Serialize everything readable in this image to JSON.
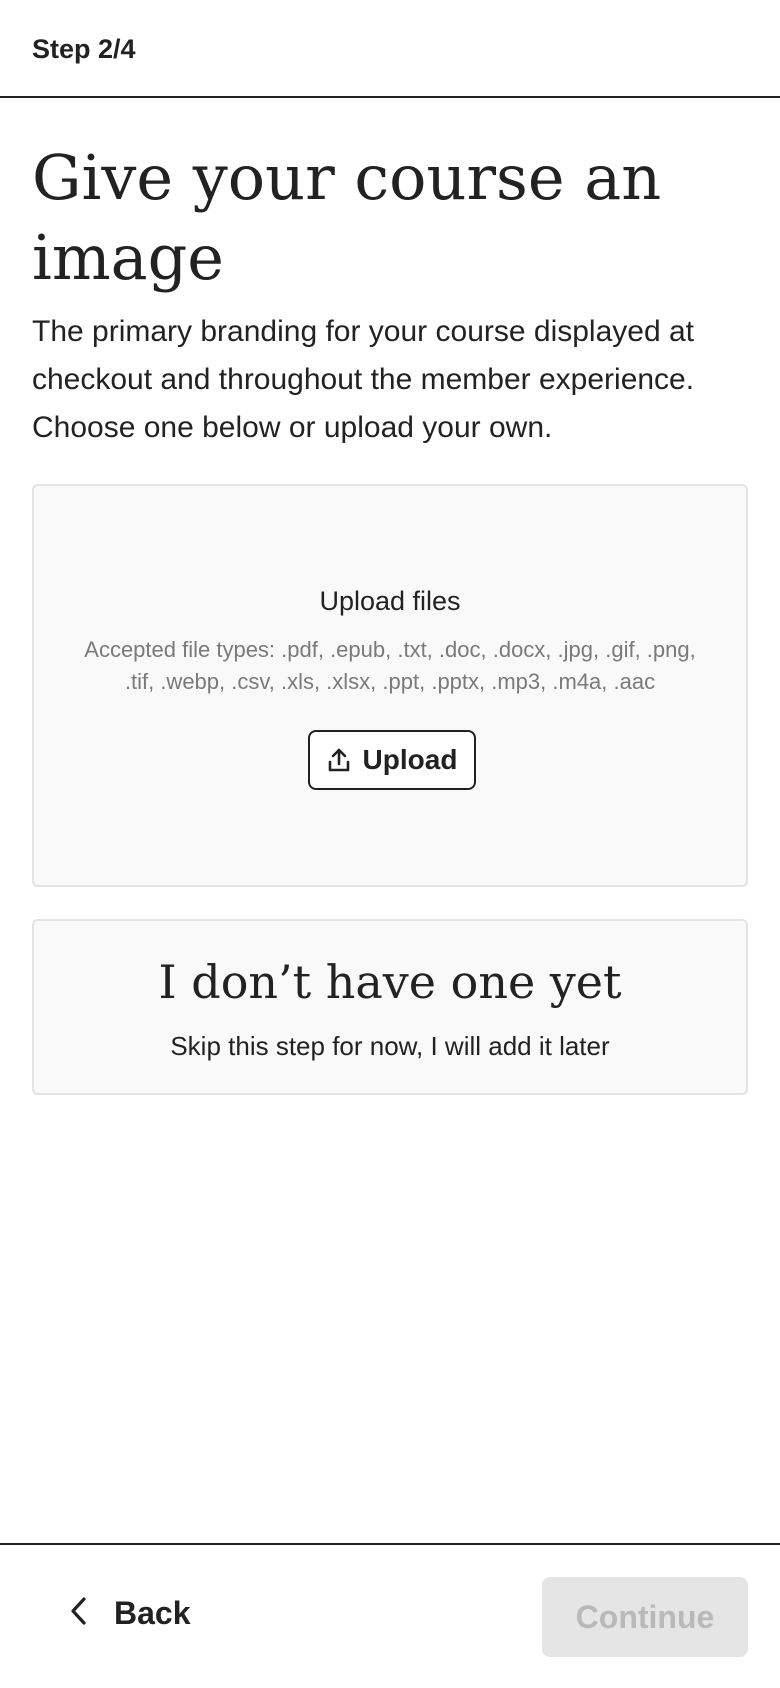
{
  "header": {
    "step_label": "Step 2/4"
  },
  "main": {
    "title": "Give your course an image",
    "subtitle": "The primary branding for your course displayed at checkout and throughout the member experience. Choose one below or upload your own."
  },
  "upload": {
    "title": "Upload files",
    "accepted_types": "Accepted file types: .pdf, .epub, .txt, .doc, .docx, .jpg, .gif, .png, .tif, .webp, .csv, .xls, .xlsx, .ppt, .pptx, .mp3, .m4a, .aac",
    "button_label": "Upload",
    "button_icon": "upload-icon"
  },
  "skip": {
    "title": "I don’t have one yet",
    "subtitle": "Skip this step for now, I will add it later"
  },
  "footer": {
    "back_label": "Back",
    "back_icon": "chevron-left-icon",
    "continue_label": "Continue",
    "continue_disabled": true
  },
  "colors": {
    "text": "#222222",
    "muted_text": "#7a7a7a",
    "card_background": "#f9f9f9",
    "card_border": "#e3e3e3",
    "disabled_button_bg": "#e5e5e5",
    "disabled_button_text": "#b9b9b9"
  }
}
